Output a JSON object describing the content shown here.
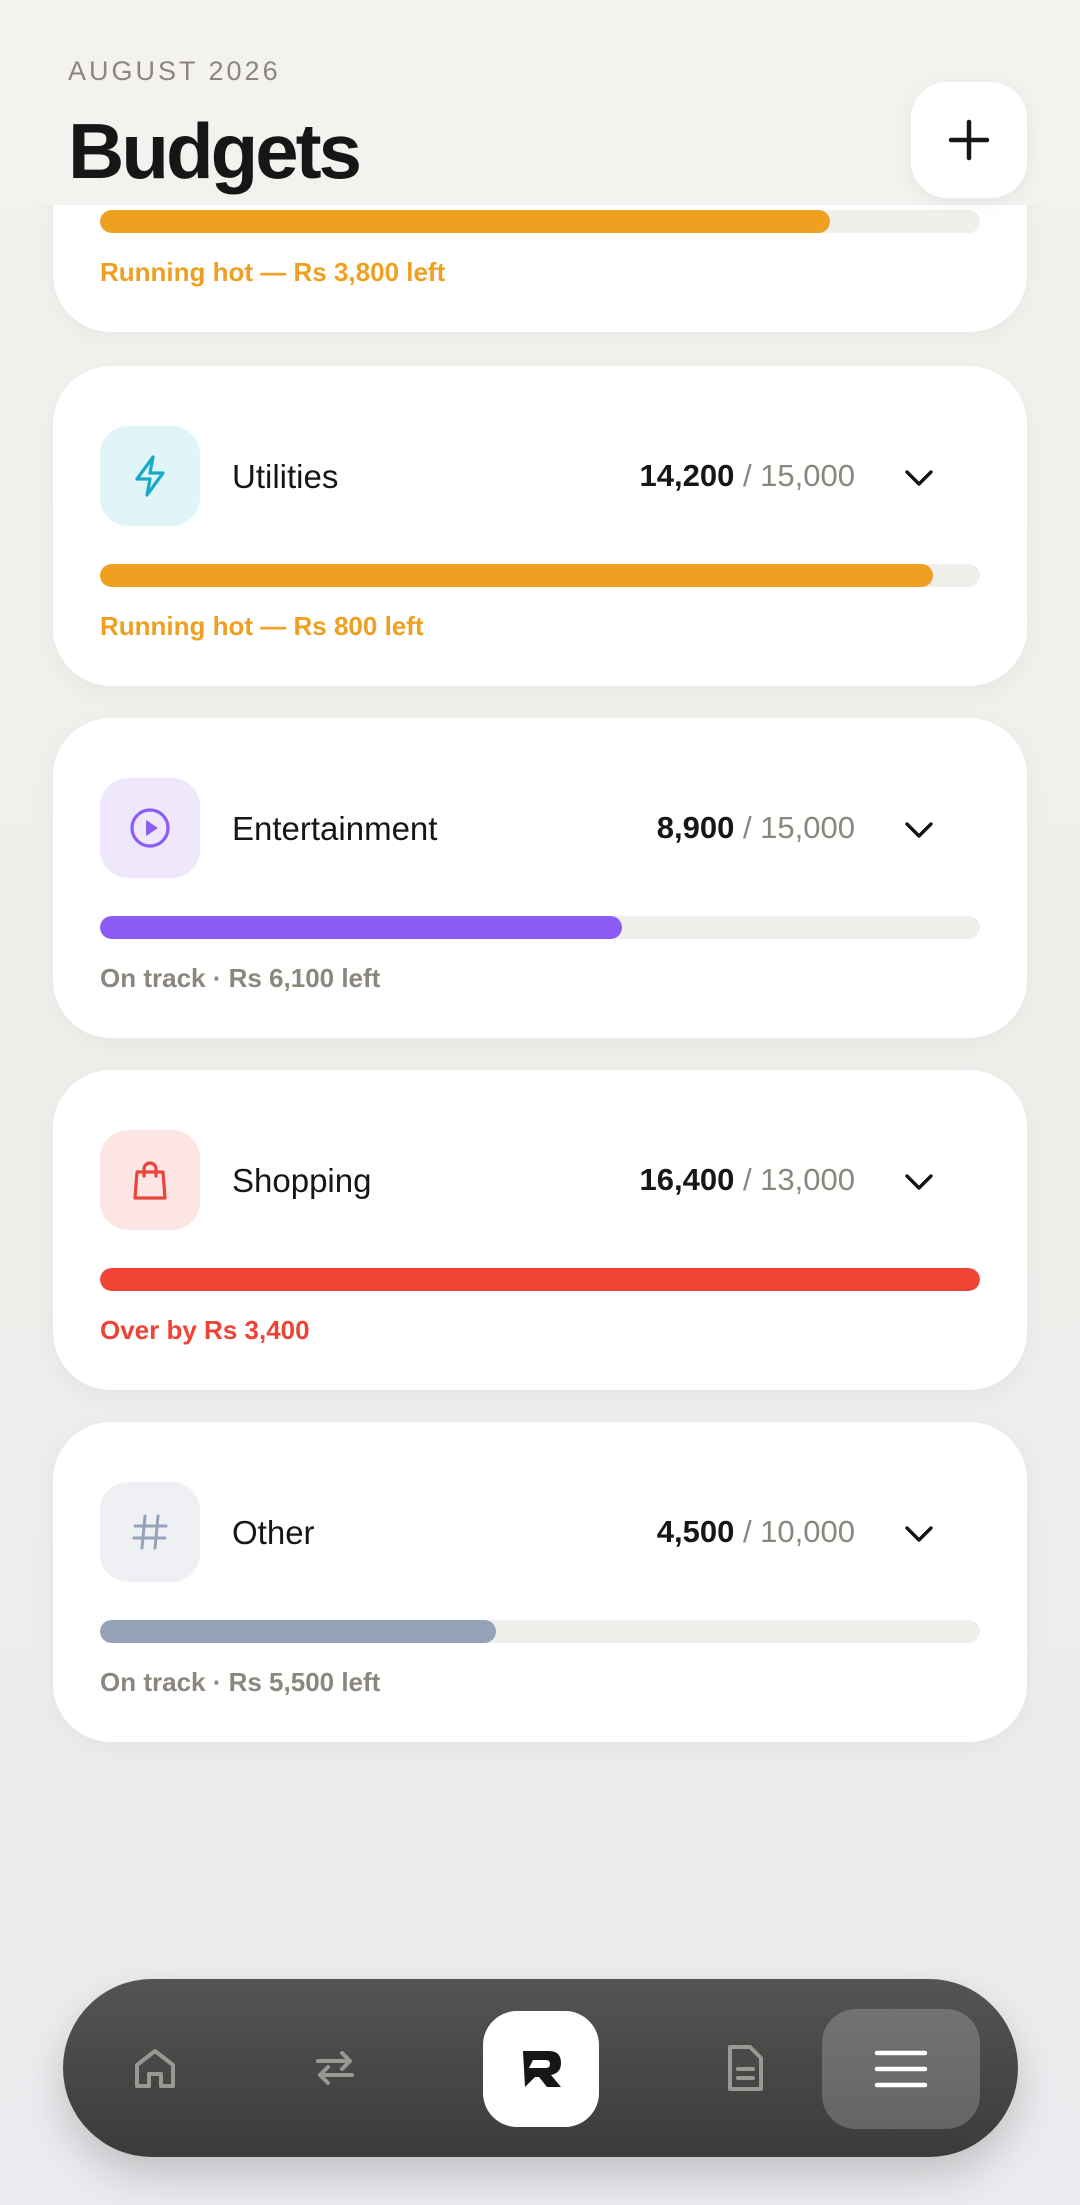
{
  "header": {
    "month": "AUGUST 2026",
    "title": "Budgets"
  },
  "budgets": [
    {
      "name": "",
      "spent": "",
      "limit": "",
      "progress": 0.83,
      "status": "Running hot — Rs 3,800 left",
      "status_color": "#f0a020",
      "bar_color": "#f0a020"
    },
    {
      "name": "Utilities",
      "spent": "14,200",
      "limit": "/ 15,000",
      "progress": 0.947,
      "status": "Running hot — Rs 800 left",
      "status_color": "#f0a020",
      "bar_color": "#f0a020",
      "icon": "lightning-icon",
      "icon_color": "#1aa9c9",
      "icon_bg": "#e0f5f8"
    },
    {
      "name": "Entertainment",
      "spent": "8,900",
      "limit": "/ 15,000",
      "progress": 0.593,
      "status": "On track · Rs 6,100 left",
      "status_color": "#8b877e",
      "bar_color": "#8b5cf6",
      "icon": "play-icon",
      "icon_color": "#8b5cf6",
      "icon_bg": "#efe8fd"
    },
    {
      "name": "Shopping",
      "spent": "16,400",
      "limit": "/ 13,000",
      "progress": 1.0,
      "status": "Over by Rs 3,400",
      "status_color": "#ef4335",
      "bar_color": "#ef4335",
      "icon": "shopping-bag-icon",
      "icon_color": "#e8463c",
      "icon_bg": "#fde5e4"
    },
    {
      "name": "Other",
      "spent": "4,500",
      "limit": "/ 10,000",
      "progress": 0.45,
      "status": "On track · Rs 5,500 left",
      "status_color": "#8b877e",
      "bar_color": "#94a3b8",
      "icon": "hash-icon",
      "icon_color": "#94a3b8",
      "icon_bg": "#eef0f4"
    }
  ],
  "tabbar": {
    "tabs": [
      "home-icon",
      "transfer-icon",
      "app-logo-icon",
      "document-icon",
      "menu-icon"
    ],
    "active": "menu-icon"
  }
}
